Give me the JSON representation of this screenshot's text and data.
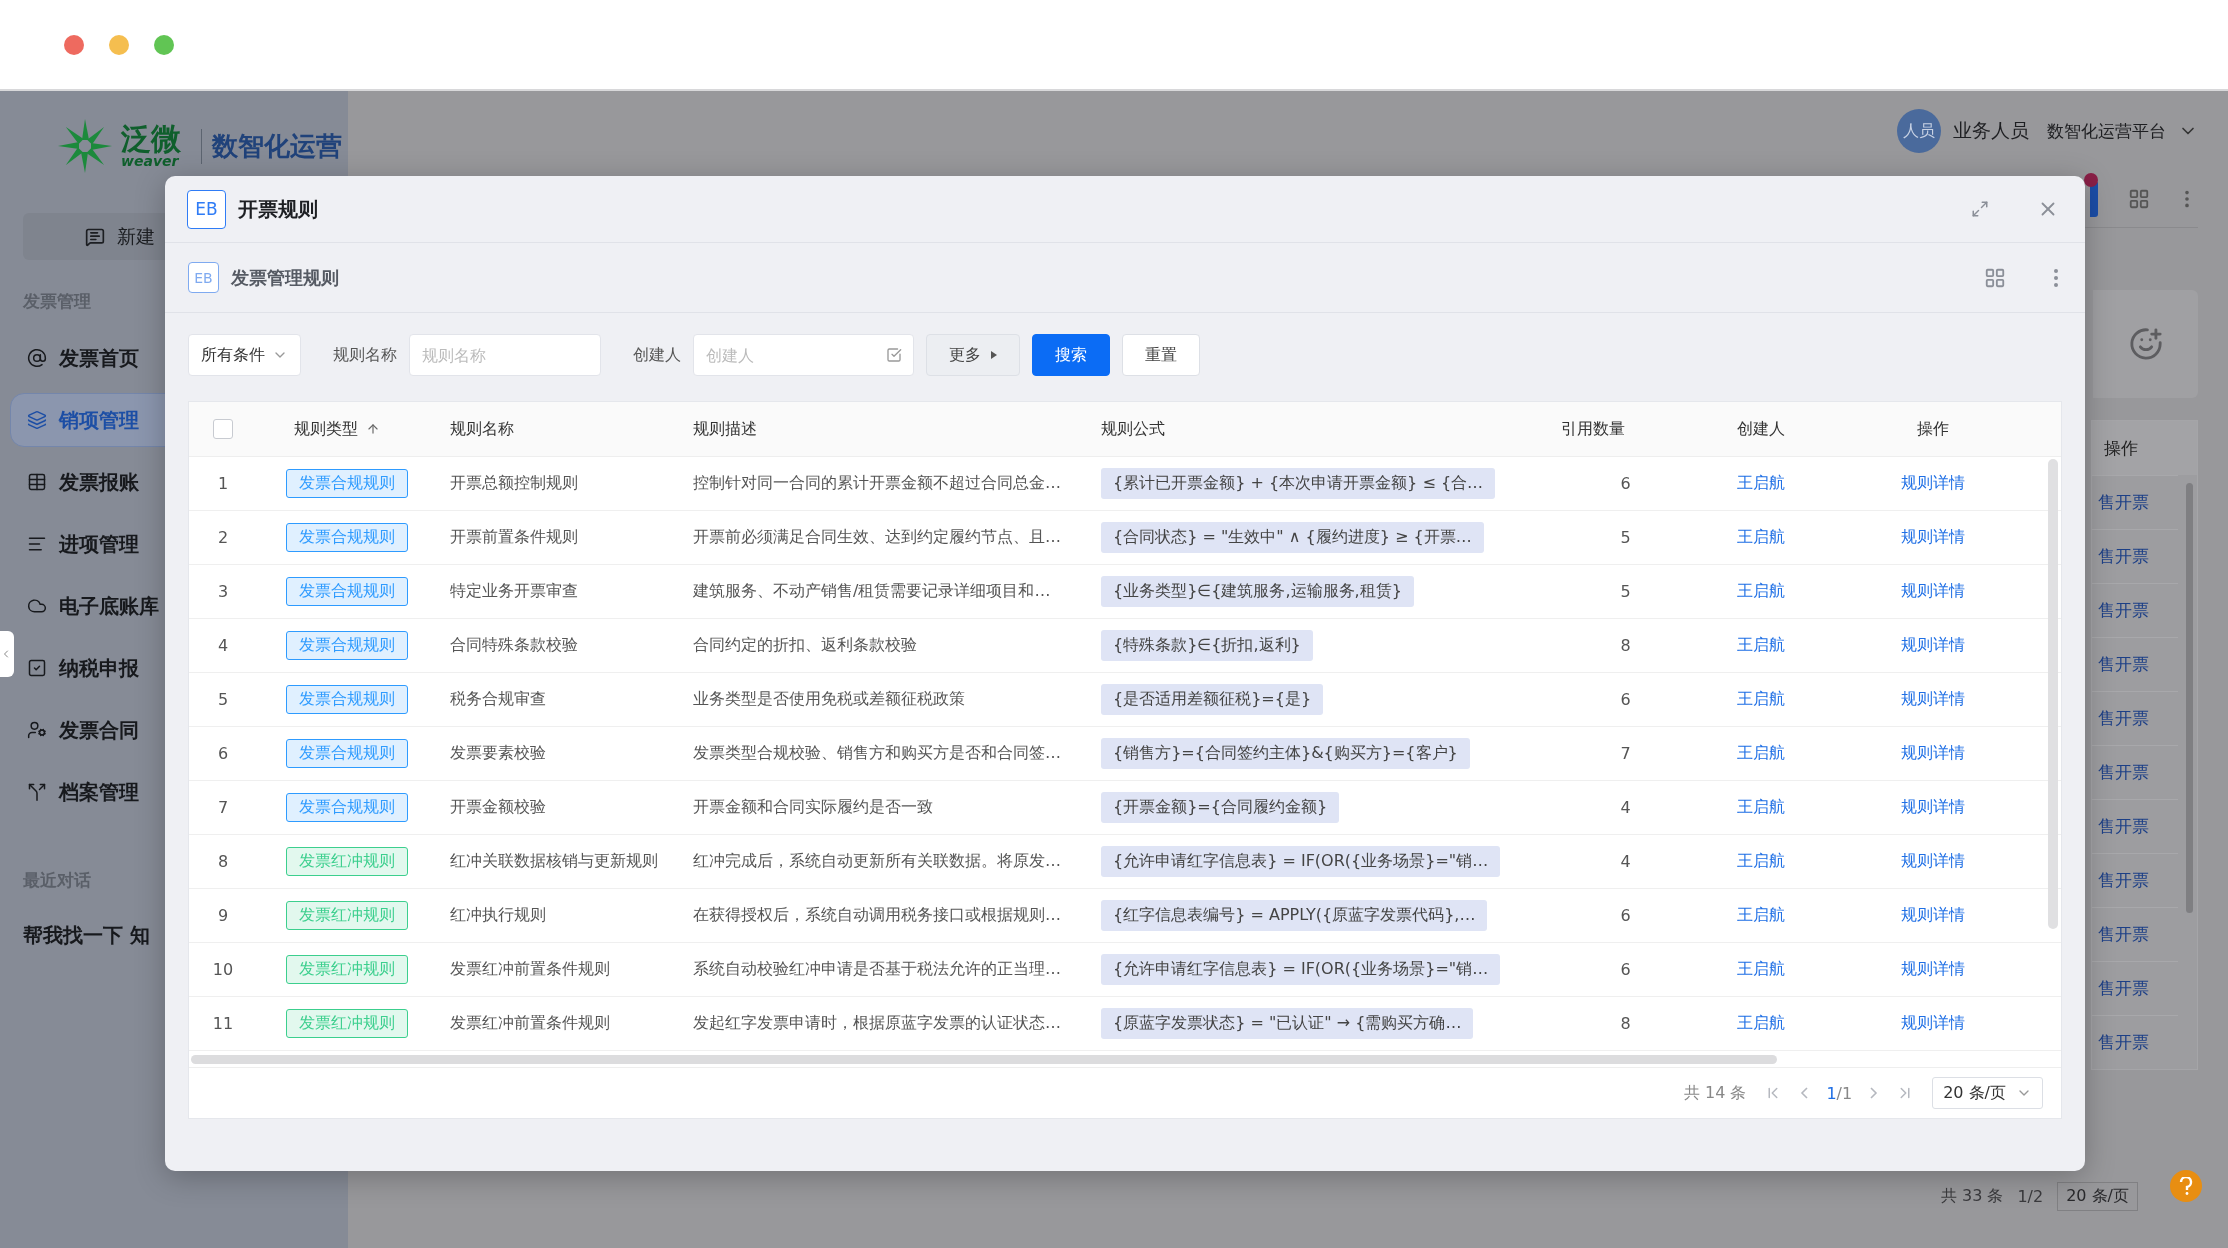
{
  "sidebar": {
    "logo": {
      "brand": "泛微",
      "brand_latin": "weaver",
      "product": "数智化运营"
    },
    "new_chat": "新建",
    "section": "发票管理",
    "items": [
      {
        "label": "发票首页",
        "selected": false
      },
      {
        "label": "销项管理",
        "selected": true
      },
      {
        "label": "发票报账",
        "selected": false
      },
      {
        "label": "进项管理",
        "selected": false
      },
      {
        "label": "电子底账库",
        "selected": false
      },
      {
        "label": "纳税申报",
        "selected": false
      },
      {
        "label": "发票合同",
        "selected": false
      },
      {
        "label": "档案管理",
        "selected": false
      }
    ],
    "recent_title": "最近对话",
    "recent": [
      "帮我找一下 知"
    ]
  },
  "header": {
    "avatar": "人员",
    "user": "业务人员",
    "platform": "数智化运营平台"
  },
  "background_table": {
    "action_header": "操作",
    "action_cells": [
      "售开票",
      "售开票",
      "售开票",
      "售开票",
      "售开票",
      "售开票",
      "售开票",
      "售开票",
      "售开票",
      "售开票",
      "售开票"
    ]
  },
  "background_pagination": {
    "total": "共 33 条",
    "page": "1/2",
    "page_size": "20 条/页"
  },
  "modal": {
    "badge": "EB",
    "title": "开票规则",
    "page_badge": "EB",
    "page_title": "发票管理规则",
    "filter": {
      "scope": "所有条件",
      "name_label": "规则名称",
      "name_placeholder": "规则名称",
      "creator_label": "创建人",
      "creator_placeholder": "创建人",
      "more": "更多",
      "search": "搜索",
      "reset": "重置"
    },
    "table": {
      "select_all_checked": false,
      "columns": [
        "规则类型",
        "规则名称",
        "规则描述",
        "规则公式",
        "引用数量",
        "创建人",
        "操作"
      ],
      "rows": [
        {
          "index": "1",
          "type": {
            "text": "发票合规规则",
            "color": "#2e9bff"
          },
          "name": "开票总额控制规则",
          "description": "控制针对同一合同的累计开票金额不超过合同总金…",
          "formula": "{累计已开票金额} + {本次申请开票金额} ≤ {合…",
          "references": "6",
          "creator": "王启航",
          "action": "规则详情"
        },
        {
          "index": "2",
          "type": {
            "text": "发票合规规则",
            "color": "#2e9bff"
          },
          "name": "开票前置条件规则",
          "description": "开票前必须满足合同生效、达到约定履约节点、且…",
          "formula": "{合同状态} = \"生效中\" ∧ {履约进度} ≥ {开票…",
          "references": "5",
          "creator": "王启航",
          "action": "规则详情"
        },
        {
          "index": "3",
          "type": {
            "text": "发票合规规则",
            "color": "#2e9bff"
          },
          "name": "特定业务开票审查",
          "description": "建筑服务、不动产销售/租赁需要记录详细项目和…",
          "formula": "{业务类型}∈{建筑服务,运输服务,租赁}",
          "references": "5",
          "creator": "王启航",
          "action": "规则详情"
        },
        {
          "index": "4",
          "type": {
            "text": "发票合规规则",
            "color": "#2e9bff"
          },
          "name": "合同特殊条款校验",
          "description": "合同约定的折扣、返利条款校验",
          "formula": "{特殊条款}∈{折扣,返利}",
          "references": "8",
          "creator": "王启航",
          "action": "规则详情"
        },
        {
          "index": "5",
          "type": {
            "text": "发票合规规则",
            "color": "#2e9bff"
          },
          "name": "税务合规审查",
          "description": "业务类型是否使用免税或差额征税政策",
          "formula": "{是否适用差额征税}={是}",
          "references": "6",
          "creator": "王启航",
          "action": "规则详情"
        },
        {
          "index": "6",
          "type": {
            "text": "发票合规规则",
            "color": "#2e9bff"
          },
          "name": "发票要素校验",
          "description": "发票类型合规校验、销售方和购买方是否和合同签…",
          "formula": "{销售方}={合同签约主体}&{购买方}={客户}",
          "references": "7",
          "creator": "王启航",
          "action": "规则详情"
        },
        {
          "index": "7",
          "type": {
            "text": "发票合规规则",
            "color": "#2e9bff"
          },
          "name": "开票金额校验",
          "description": "开票金额和合同实际履约是否一致",
          "formula": "{开票金额}={合同履约金额}",
          "references": "4",
          "creator": "王启航",
          "action": "规则详情"
        },
        {
          "index": "8",
          "type": {
            "text": "发票红冲规则",
            "color": "#3ccf8e"
          },
          "name": "红冲关联数据核销与更新规则",
          "description": "红冲完成后，系统自动更新所有关联数据。将原发…",
          "formula": "{允许申请红字信息表} = IF(OR({业务场景}=\"销…",
          "references": "4",
          "creator": "王启航",
          "action": "规则详情"
        },
        {
          "index": "9",
          "type": {
            "text": "发票红冲规则",
            "color": "#3ccf8e"
          },
          "name": "红冲执行规则",
          "description": "在获得授权后，系统自动调用税务接口或根据规则…",
          "formula": "{红字信息表编号} = APPLY({原蓝字发票代码},…",
          "references": "6",
          "creator": "王启航",
          "action": "规则详情"
        },
        {
          "index": "10",
          "type": {
            "text": "发票红冲规则",
            "color": "#3ccf8e"
          },
          "name": "发票红冲前置条件规则",
          "description": "系统自动校验红冲申请是否基于税法允许的正当理…",
          "formula": "{允许申请红字信息表} = IF(OR({业务场景}=\"销…",
          "references": "6",
          "creator": "王启航",
          "action": "规则详情"
        },
        {
          "index": "11",
          "type": {
            "text": "发票红冲规则",
            "color": "#3ccf8e"
          },
          "name": "发票红冲前置条件规则",
          "description": "发起红字发票申请时，根据原蓝字发票的认证状态…",
          "formula": "{原蓝字发票状态} = \"已认证\" → {需购买方确…",
          "references": "8",
          "creator": "王启航",
          "action": "规则详情"
        }
      ]
    },
    "pagination": {
      "total": "共 14 条",
      "current": "1",
      "pages": "/1",
      "page_size": "20 条/页"
    }
  }
}
